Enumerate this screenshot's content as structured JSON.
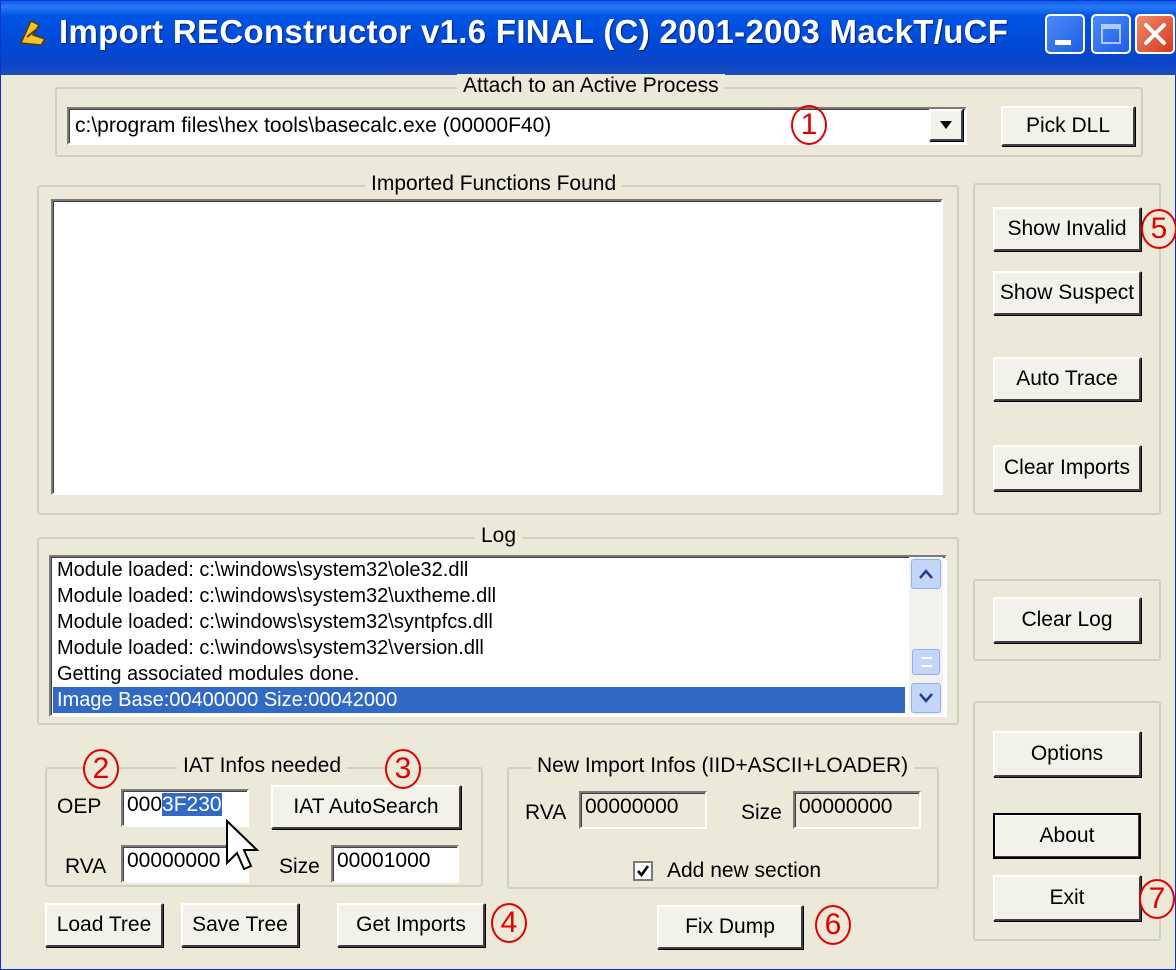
{
  "window": {
    "title": "Import REConstructor v1.6 FINAL (C) 2001-2003 MackT/uCF",
    "icons": [
      "app-icon",
      "minimize-icon",
      "maximize-icon",
      "close-icon"
    ]
  },
  "attach": {
    "group_label": "Attach to an Active Process",
    "process_value": "c:\\program files\\hex tools\\basecalc.exe (00000F40)",
    "pick_dll_label": "Pick DLL"
  },
  "imported": {
    "group_label": "Imported Functions Found",
    "items": []
  },
  "side_buttons": {
    "show_invalid": "Show Invalid",
    "show_suspect": "Show Suspect",
    "auto_trace": "Auto Trace",
    "clear_imports": "Clear Imports",
    "clear_log": "Clear Log",
    "options": "Options",
    "about": "About",
    "exit": "Exit"
  },
  "log": {
    "group_label": "Log",
    "lines": [
      "Module loaded: c:\\windows\\system32\\ole32.dll",
      "Module loaded: c:\\windows\\system32\\uxtheme.dll",
      "Module loaded: c:\\windows\\system32\\syntpfcs.dll",
      "Module loaded: c:\\windows\\system32\\version.dll",
      "Getting associated modules done.",
      "Image Base:00400000 Size:00042000"
    ]
  },
  "iat": {
    "group_label": "IAT Infos needed",
    "oep_label": "OEP",
    "oep_prefix": "000",
    "oep_selected": "3F230",
    "rva_label": "RVA",
    "rva_value": "00000000",
    "size_label": "Size",
    "size_value": "00001000",
    "autosearch_label": "IAT AutoSearch"
  },
  "new_import": {
    "group_label": "New Import Infos (IID+ASCII+LOADER)",
    "rva_label": "RVA",
    "rva_value": "00000000",
    "size_label": "Size",
    "size_value": "00000000",
    "add_section_label": "Add new section",
    "add_section_checked": true
  },
  "bottom_buttons": {
    "load_tree": "Load Tree",
    "save_tree": "Save Tree",
    "get_imports": "Get Imports",
    "fix_dump": "Fix Dump"
  },
  "callouts": [
    "1",
    "2",
    "3",
    "4",
    "5",
    "6",
    "7"
  ],
  "colors": {
    "titlebar": "#0055e5",
    "face": "#ece9d8",
    "selection": "#316ac5",
    "callout": "#e00000"
  }
}
